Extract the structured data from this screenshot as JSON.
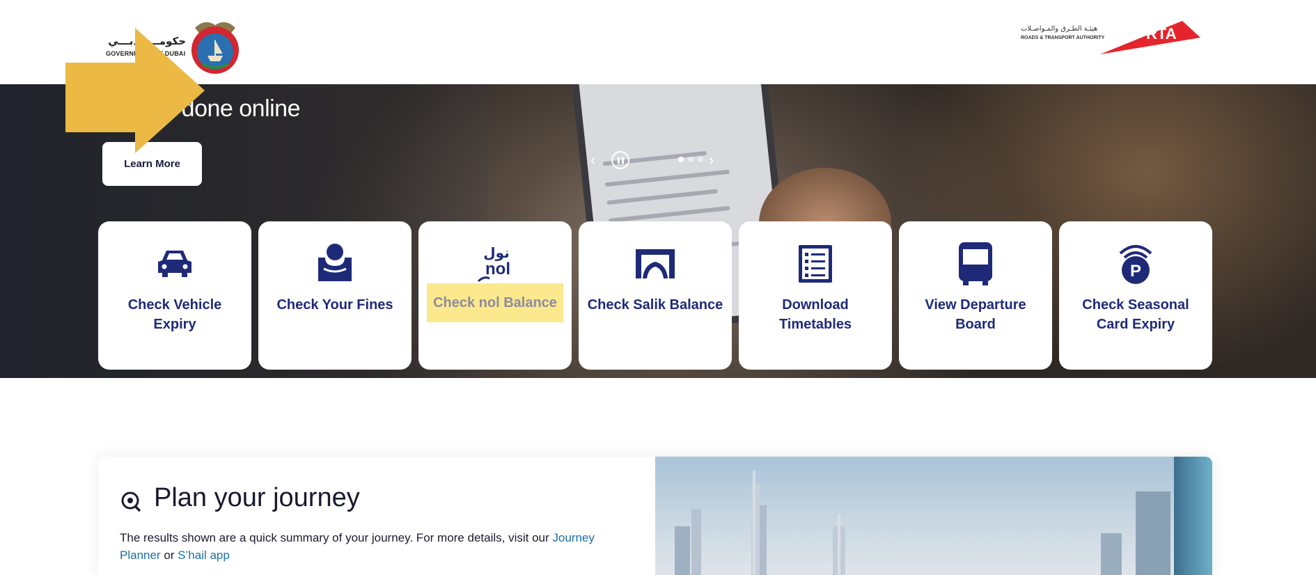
{
  "header": {
    "gov_logo": {
      "arabic_text": "حكومـــة دبـــي",
      "english_text": "GOVERNMENT OF DUBAI",
      "icon": "dubai-emblem-icon"
    },
    "rta_logo": {
      "arabic_text": "هيئـة الطـرق والمـواصـلات",
      "english_text": "ROADS & TRANSPORT AUTHORITY",
      "mark_text": "RTA",
      "color": "#e4262c"
    }
  },
  "hero": {
    "title": "censes done online",
    "learn_more_label": "Learn More",
    "carousel": {
      "prev_icon": "chevron-left-icon",
      "pause_icon": "pause-icon",
      "next_icon": "chevron-right-icon",
      "slides": 3,
      "active_slide": 1
    }
  },
  "overlay": {
    "arrow_icon": "arrow-right-icon",
    "color": "#ecb944"
  },
  "services": [
    {
      "label": "Check Vehicle Expiry",
      "icon": "car-icon"
    },
    {
      "label": "Check Your Fines",
      "icon": "fines-icon"
    },
    {
      "label": "Check nol Balance",
      "icon": "nol-icon",
      "icon_text_ar": "نول",
      "icon_text_en": "nol",
      "highlighted": true
    },
    {
      "label": "Check Salik Balance",
      "icon": "salik-gate-icon"
    },
    {
      "label": "Download Timetables",
      "icon": "timetable-list-icon"
    },
    {
      "label": "View Departure Board",
      "icon": "bus-icon"
    },
    {
      "label": "Check Seasonal Card Expiry",
      "icon": "parking-signal-icon"
    }
  ],
  "journey": {
    "icon": "location-search-icon",
    "title": "Plan your journey",
    "desc_text": "The results shown are a quick summary of your journey. For more details, visit our ",
    "link1": "Journey Planner",
    "or_text": " or ",
    "link2": "S’hail app"
  },
  "colors": {
    "brand_navy": "#1e2a78",
    "link_blue": "#1b6fa8",
    "highlight": "#fce88d"
  }
}
